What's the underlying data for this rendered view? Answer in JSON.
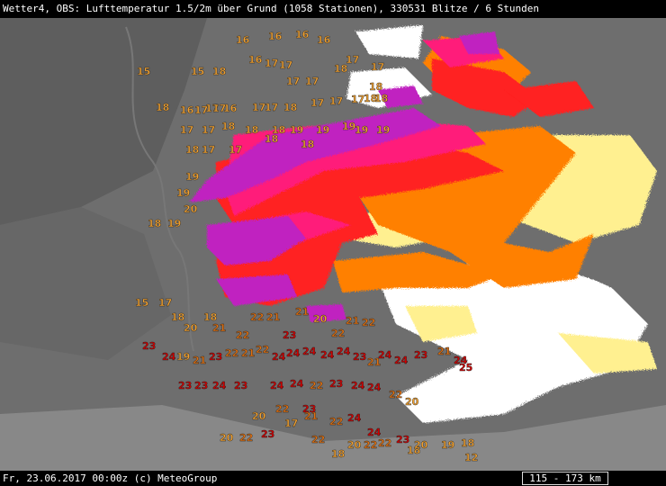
{
  "header": {
    "title": "Wetter4, OBS: Lufttemperatur 1.5/2m über Grund (1058 Stationen), 330531 Blitze / 6 Stunden"
  },
  "footer": {
    "timestamp": "Fr, 23.06.2017 00:00z (c) MeteoGroup",
    "scale": "115 - 173 km"
  },
  "colors": {
    "background": "#6e6e6e",
    "temp_low": "#f0a030",
    "temp_mid": "#e07010",
    "temp_high": "#d00000",
    "lightning_oldest": "#ffffff",
    "lightning_old": "#fff090",
    "lightning_mid": "#ff8000",
    "lightning_recent": "#ff2020",
    "lightning_newer": "#ff1f7a",
    "lightning_newest": "#c020c0"
  },
  "stations": [
    {
      "v": "16"
    },
    {
      "v": "16"
    },
    {
      "v": "16"
    },
    {
      "v": "16"
    },
    {
      "v": "17"
    },
    {
      "v": "17"
    },
    {
      "v": "16"
    },
    {
      "v": "15"
    },
    {
      "v": "15"
    },
    {
      "v": "18"
    },
    {
      "v": "17"
    },
    {
      "v": "17"
    },
    {
      "v": "18"
    },
    {
      "v": "17"
    },
    {
      "v": "17"
    },
    {
      "v": "18"
    },
    {
      "v": "16"
    },
    {
      "v": "18"
    },
    {
      "v": "16"
    },
    {
      "v": "17"
    },
    {
      "v": "17"
    },
    {
      "v": "17"
    },
    {
      "v": "17"
    },
    {
      "v": "17"
    },
    {
      "v": "18"
    },
    {
      "v": "17"
    },
    {
      "v": "17"
    },
    {
      "v": "17"
    },
    {
      "v": "18"
    },
    {
      "v": "18"
    },
    {
      "v": "17"
    },
    {
      "v": "17"
    },
    {
      "v": "18"
    },
    {
      "v": "18"
    },
    {
      "v": "18"
    },
    {
      "v": "19"
    },
    {
      "v": "19"
    },
    {
      "v": "19"
    },
    {
      "v": "19"
    },
    {
      "v": "19"
    },
    {
      "v": "18"
    },
    {
      "v": "18"
    },
    {
      "v": "18"
    },
    {
      "v": "17"
    },
    {
      "v": "17"
    },
    {
      "v": "19"
    },
    {
      "v": "19"
    },
    {
      "v": "20"
    },
    {
      "v": "19"
    },
    {
      "v": "18"
    },
    {
      "v": "15"
    },
    {
      "v": "17"
    },
    {
      "v": "18"
    },
    {
      "v": "18"
    },
    {
      "v": "20"
    },
    {
      "v": "21"
    },
    {
      "v": "22"
    },
    {
      "v": "22"
    },
    {
      "v": "21"
    },
    {
      "v": "23"
    },
    {
      "v": "21"
    },
    {
      "v": "20"
    },
    {
      "v": "22"
    },
    {
      "v": "21"
    },
    {
      "v": "22"
    },
    {
      "v": "23"
    },
    {
      "v": "24"
    },
    {
      "v": "19"
    },
    {
      "v": "21"
    },
    {
      "v": "23"
    },
    {
      "v": "22"
    },
    {
      "v": "21"
    },
    {
      "v": "22"
    },
    {
      "v": "24"
    },
    {
      "v": "24"
    },
    {
      "v": "24"
    },
    {
      "v": "24"
    },
    {
      "v": "24"
    },
    {
      "v": "23"
    },
    {
      "v": "21"
    },
    {
      "v": "24"
    },
    {
      "v": "24"
    },
    {
      "v": "23"
    },
    {
      "v": "21"
    },
    {
      "v": "24"
    },
    {
      "v": "25"
    },
    {
      "v": "23"
    },
    {
      "v": "23"
    },
    {
      "v": "24"
    },
    {
      "v": "23"
    },
    {
      "v": "24"
    },
    {
      "v": "24"
    },
    {
      "v": "22"
    },
    {
      "v": "23"
    },
    {
      "v": "24"
    },
    {
      "v": "24"
    },
    {
      "v": "22"
    },
    {
      "v": "20"
    },
    {
      "v": "23"
    },
    {
      "v": "22"
    },
    {
      "v": "20"
    },
    {
      "v": "17"
    },
    {
      "v": "21"
    },
    {
      "v": "22"
    },
    {
      "v": "24"
    },
    {
      "v": "24"
    },
    {
      "v": "20"
    },
    {
      "v": "22"
    },
    {
      "v": "23"
    },
    {
      "v": "22"
    },
    {
      "v": "12"
    },
    {
      "v": "18"
    },
    {
      "v": "18"
    },
    {
      "v": "19"
    },
    {
      "v": "20"
    },
    {
      "v": "23"
    },
    {
      "v": "22"
    },
    {
      "v": "22"
    },
    {
      "v": "20"
    },
    {
      "v": "18"
    }
  ]
}
